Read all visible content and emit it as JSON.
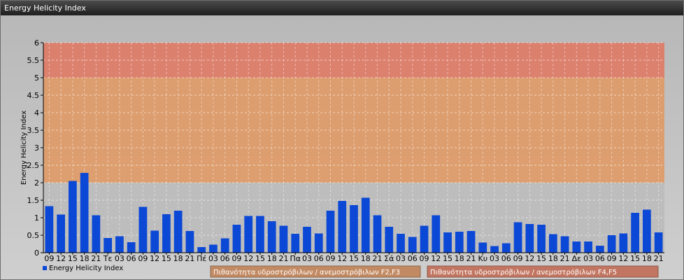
{
  "window": {
    "title": "Energy Helicity Index"
  },
  "colors": {
    "bar": "#0b48d6",
    "zone_high": "#e07a66",
    "zone_mid": "#e09a66",
    "zone_low": "#bdbdbd",
    "legend_box_mid": "#c28a63",
    "legend_box_high": "#c27661"
  },
  "chart_data": {
    "type": "bar",
    "ylabel": "Energy Helicity Index",
    "ylim": [
      0,
      6
    ],
    "yticks": [
      "0",
      "0.5",
      "1",
      "1.5",
      "2",
      "2.5",
      "3",
      "3.5",
      "4",
      "4.5",
      "5",
      "5.5",
      "6"
    ],
    "grid": true,
    "categories": [
      "09",
      "12",
      "15",
      "18",
      "21",
      "Τε",
      "03",
      "06",
      "09",
      "12",
      "15",
      "18",
      "21",
      "Πέ",
      "03",
      "06",
      "09",
      "12",
      "15",
      "18",
      "21",
      "Πα",
      "03",
      "06",
      "09",
      "12",
      "15",
      "18",
      "21",
      "Σά",
      "03",
      "06",
      "09",
      "12",
      "15",
      "18",
      "21",
      "Κυ",
      "03",
      "06",
      "09",
      "12",
      "15",
      "18",
      "21",
      "Δε",
      "03",
      "06",
      "09",
      "12",
      "15",
      "18",
      "21"
    ],
    "series": [
      {
        "name": "Energy Helicity Index",
        "values": [
          1.33,
          1.09,
          2.05,
          2.28,
          1.07,
          0.42,
          0.47,
          0.3,
          1.31,
          0.63,
          1.1,
          1.2,
          0.62,
          0.16,
          0.23,
          0.41,
          0.8,
          1.05,
          1.05,
          0.9,
          0.77,
          0.54,
          0.74,
          0.55,
          1.2,
          1.48,
          1.36,
          1.57,
          1.07,
          0.74,
          0.54,
          0.45,
          0.77,
          1.07,
          0.58,
          0.6,
          0.62,
          0.29,
          0.19,
          0.27,
          0.87,
          0.82,
          0.8,
          0.53,
          0.47,
          0.32,
          0.32,
          0.2,
          0.5,
          0.55,
          1.14,
          1.23,
          0.58
        ]
      }
    ],
    "zones": [
      {
        "from": 2,
        "to": 5,
        "label": "Πιθανότητα υδροστρόβιλων / ανεμοστρόβιλων F2,F3"
      },
      {
        "from": 5,
        "to": 6,
        "label": "Πιθανότητα υδροστρόβιλων / ανεμοστρόβιλων F4,F5"
      }
    ],
    "legend": "bottom-left"
  }
}
